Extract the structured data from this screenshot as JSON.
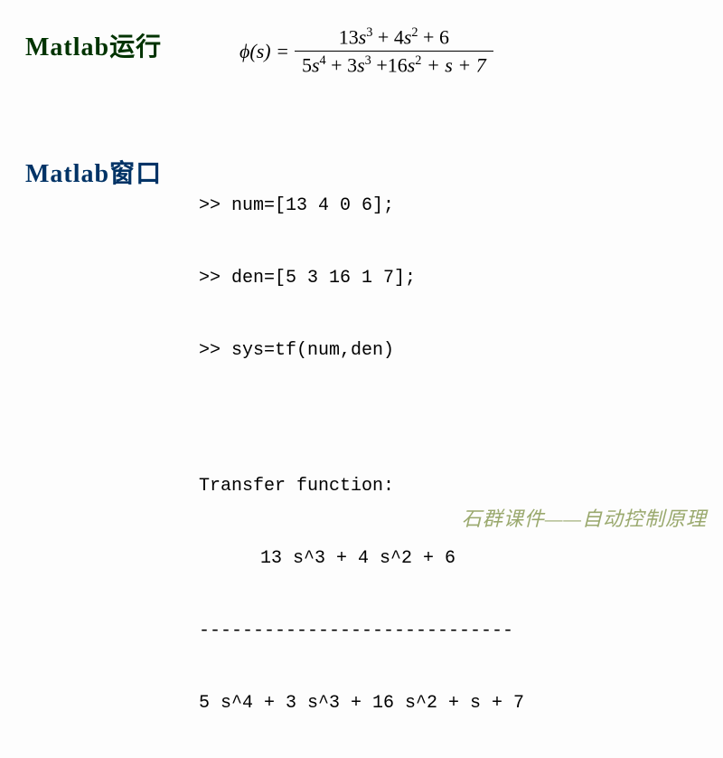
{
  "headings": {
    "run": "Matlab运行",
    "window": "Matlab窗口"
  },
  "equation": {
    "lhs": "ϕ(s) =",
    "numerator": {
      "t1c": "13",
      "t1v": "s",
      "t1e": "3",
      "t2c": "+ 4",
      "t2v": "s",
      "t2e": "2",
      "t3": "+ 6"
    },
    "denominator": {
      "t1c": "5",
      "t1v": "s",
      "t1e": "4",
      "t2c": "+ 3",
      "t2v": "s",
      "t2e": "3",
      "t3c": "+16",
      "t3v": "s",
      "t3e": "2",
      "t4": "+ s + 7"
    }
  },
  "code": {
    "line1": ">> num=[13 4 0 6];",
    "line2": ">> den=[5 3 16 1 7];",
    "line3": ">> sys=tf(num,den)",
    "outTitle": "Transfer function:",
    "tfNum": "13 s^3 + 4 s^2 + 6",
    "tfDash": "-----------------------------",
    "tfDen": "5 s^4 + 3 s^3 + 16 s^2 + s + 7"
  },
  "footer": "石群课件——自动控制原理"
}
